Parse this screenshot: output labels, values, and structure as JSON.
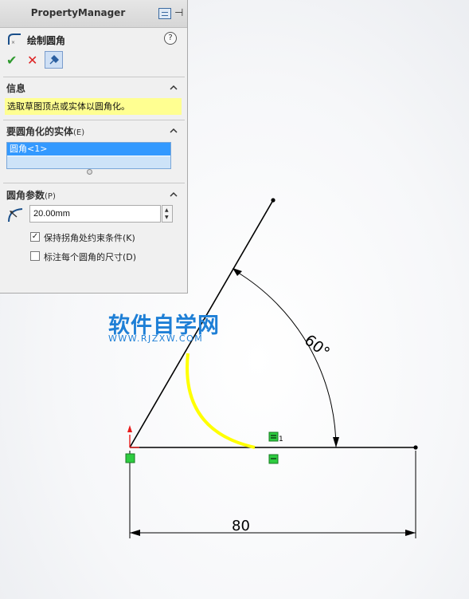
{
  "property_manager": {
    "title": "PropertyManager",
    "feature_title": "绘制圆角",
    "help": "?",
    "ok": "✔",
    "cancel": "✕",
    "info_group": {
      "title": "信息",
      "message": "选取草图顶点或实体以圆角化。"
    },
    "entities_group": {
      "title": "要圆角化的实体",
      "hotkey": "(E)",
      "selected": [
        "圆角<1>"
      ]
    },
    "params_group": {
      "title": "圆角参数",
      "hotkey": "(P)",
      "radius": "20.00mm",
      "keep_constrained": {
        "label": "保持拐角处约束条件",
        "hotkey": "(K)",
        "checked": true
      },
      "dimension_each": {
        "label": "标注每个圆角的尺寸",
        "hotkey": "(D)",
        "checked": false
      }
    }
  },
  "sketch": {
    "angle_dimension": "60°",
    "length_dimension": "80",
    "relation_label": "1",
    "colors": {
      "line": "#000000",
      "fillet": "#ffff00",
      "relation": "#2ecc40",
      "origin": "#e81b1b"
    }
  },
  "watermark": {
    "main": "软件自学网",
    "url": "WWW.RJZXW.COM"
  }
}
